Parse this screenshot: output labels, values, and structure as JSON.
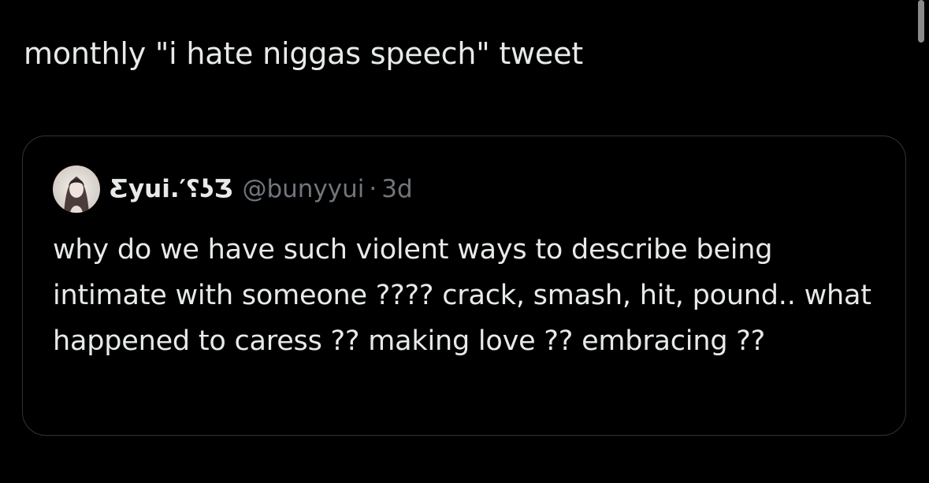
{
  "post": {
    "text": "monthly \"i hate niggas speech\" tweet"
  },
  "quote": {
    "display_name": "Ƹyui.′⸮ʖƷ",
    "handle": "@bunyyui",
    "separator": "·",
    "time": "3d",
    "text": "why do we have such violent ways to describe being intimate with someone ???? crack, smash, hit, pound.. what happened to caress ?? making love ?? embracing ??"
  },
  "colors": {
    "background": "#000000",
    "text_primary": "#e7e9ea",
    "text_secondary": "#71767b",
    "border": "#2f3336"
  },
  "icons": {
    "avatar": "profile-photo"
  }
}
